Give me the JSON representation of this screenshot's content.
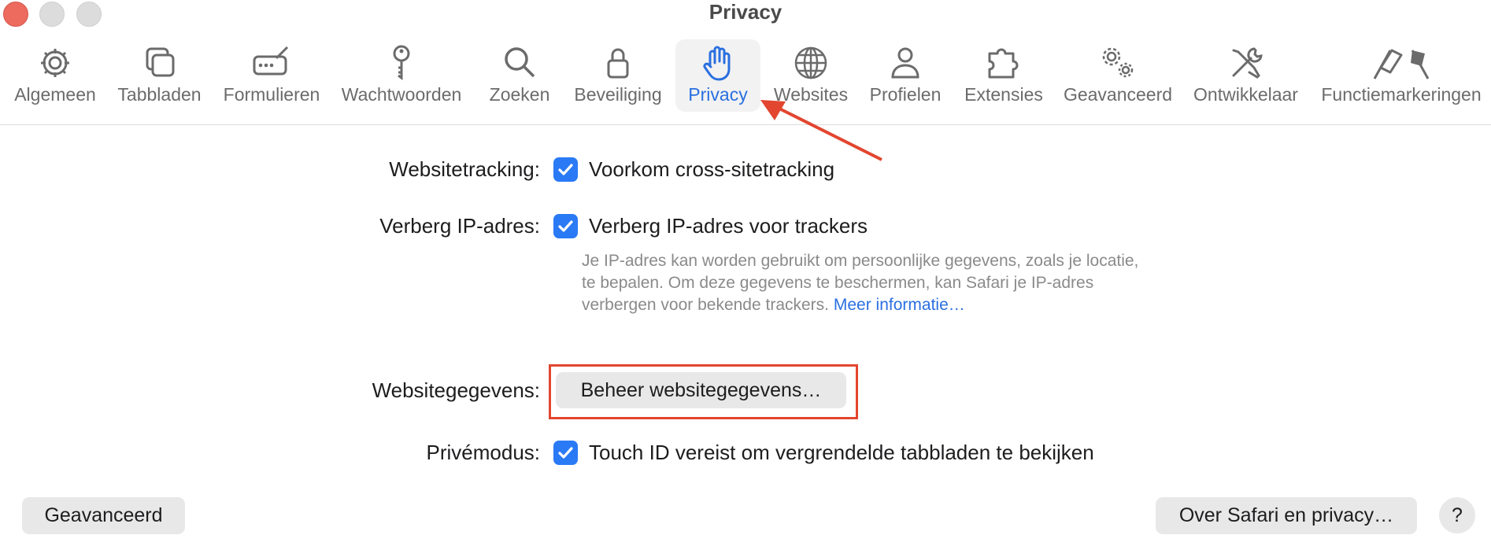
{
  "window": {
    "title": "Privacy"
  },
  "tabs": [
    {
      "id": "general",
      "label": "Algemeen",
      "icon": "gear-icon"
    },
    {
      "id": "tabs",
      "label": "Tabbladen",
      "icon": "tabs-icon"
    },
    {
      "id": "autofill",
      "label": "Formulieren",
      "icon": "pen-field-icon"
    },
    {
      "id": "passwords",
      "label": "Wachtwoorden",
      "icon": "key-icon"
    },
    {
      "id": "search",
      "label": "Zoeken",
      "icon": "magnifier-icon"
    },
    {
      "id": "security",
      "label": "Beveiliging",
      "icon": "lock-icon"
    },
    {
      "id": "privacy",
      "label": "Privacy",
      "icon": "hand-icon",
      "active": true
    },
    {
      "id": "websites",
      "label": "Websites",
      "icon": "globe-icon"
    },
    {
      "id": "profiles",
      "label": "Profielen",
      "icon": "person-icon"
    },
    {
      "id": "extensions",
      "label": "Extensies",
      "icon": "puzzle-icon"
    },
    {
      "id": "advanced",
      "label": "Geavanceerd",
      "icon": "gears-icon"
    },
    {
      "id": "developer",
      "label": "Ontwikkelaar",
      "icon": "tools-icon"
    },
    {
      "id": "feature_flags",
      "label": "Functiemarkeringen",
      "icon": "flags-icon"
    }
  ],
  "settings": {
    "tracking": {
      "label": "Websitetracking:",
      "checkbox": "Voorkom cross-sitetracking",
      "checked": true
    },
    "hide_ip": {
      "label": "Verberg IP-adres:",
      "checkbox": "Verberg IP-adres voor trackers",
      "checked": true,
      "description": "Je IP-adres kan worden gebruikt om persoonlijke gegevens, zoals je locatie, te bepalen. Om deze gegevens te beschermen, kan Safari je IP-adres verbergen voor bekende trackers.",
      "link": "Meer informatie…"
    },
    "website_data": {
      "label": "Websitegegevens:",
      "button": "Beheer websitegegevens…"
    },
    "private": {
      "label": "Privémodus:",
      "checkbox": "Touch ID vereist om vergrendelde tabbladen te bekijken",
      "checked": true
    }
  },
  "footer": {
    "advanced_button": "Geavanceerd",
    "about_button": "Over Safari en privacy…",
    "help_button": "?"
  },
  "annotations": {
    "color": "#e2462f"
  },
  "colors": {
    "accent": "#2a7af5",
    "link": "#2a6fe0"
  }
}
